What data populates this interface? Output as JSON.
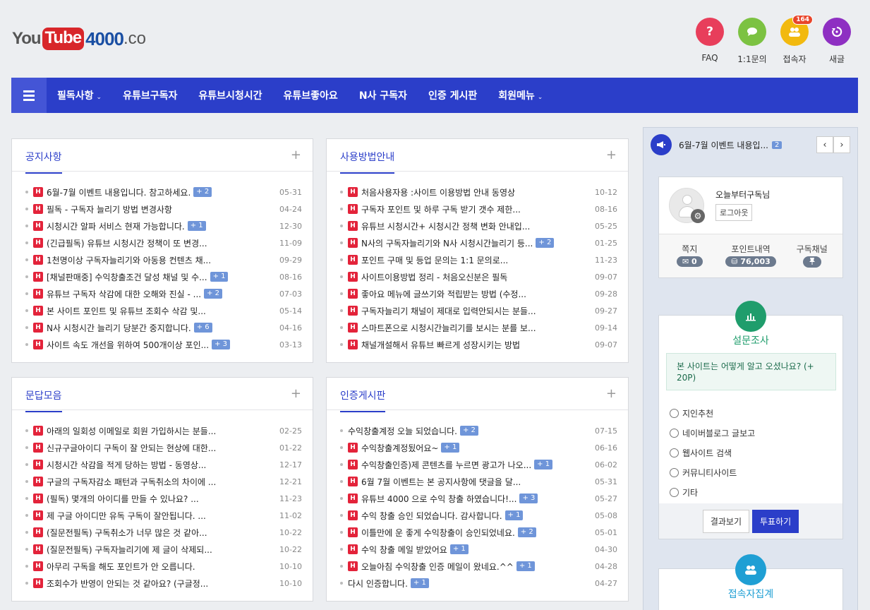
{
  "logo": {
    "you": "You",
    "tube": "Tube",
    "num": "4000",
    "co": ".co"
  },
  "top_icons": [
    {
      "label": "FAQ",
      "icon": "question-icon",
      "color": "#e83e5b",
      "glyph": "?"
    },
    {
      "label": "1:1문의",
      "icon": "chat-icon",
      "color": "#7cc242",
      "glyph": "💬"
    },
    {
      "label": "접속자",
      "icon": "users-icon",
      "color": "#f2b90f",
      "glyph": "👥",
      "badge": "164"
    },
    {
      "label": "새글",
      "icon": "refresh-icon",
      "color": "#8e2fc2",
      "glyph": "↺"
    }
  ],
  "nav": {
    "items": [
      {
        "label": "필독사항",
        "caret": true
      },
      {
        "label": "유튜브구독자"
      },
      {
        "label": "유튜브시청시간"
      },
      {
        "label": "유튜브좋아요"
      },
      {
        "label": "N사 구독자"
      },
      {
        "label": "인증 게시판"
      },
      {
        "label": "회원메뉴",
        "caret": true
      }
    ]
  },
  "boards": [
    {
      "title": "공지사항",
      "items": [
        {
          "text": "6월-7월 이벤트 내용입니다. 참고하세요.",
          "cnt": "+ 2",
          "date": "05-31",
          "h": true
        },
        {
          "text": "필독 - 구독자 늘리기 방법 변경사항",
          "date": "04-24",
          "h": true
        },
        {
          "text": "시청시간 알파 서비스 현재 가능합니다.",
          "cnt": "+ 1",
          "date": "12-30",
          "h": true
        },
        {
          "text": "(긴급필독) 유튜브 시청시간 정책이 또 변경...",
          "date": "11-09",
          "h": true
        },
        {
          "text": "1천명이상 구독자늘리기와 아동용 컨텐츠 채...",
          "date": "09-29",
          "h": true
        },
        {
          "text": "[채널판매중] 수익창출조건 달성 채널 및 수...",
          "cnt": "+ 1",
          "date": "08-16",
          "h": true
        },
        {
          "text": "유튜브 구독자 삭감에 대한 오해와 진실 - ...",
          "cnt": "+ 2",
          "date": "07-03",
          "h": true
        },
        {
          "text": "본 사이트 포인트 및 유튜브 조회수 삭감 및...",
          "date": "05-14",
          "h": true
        },
        {
          "text": "N사 시청시간 늘리기 당분간 중지합니다.",
          "cnt": "+ 6",
          "date": "04-16",
          "h": true
        },
        {
          "text": "사이트 속도 개선을 위하여 500개이상 포인...",
          "cnt": "+ 3",
          "date": "03-13",
          "h": true
        }
      ]
    },
    {
      "title": "사용방법안내",
      "items": [
        {
          "text": "처음사용자용 :사이트 이용방법 안내 동영상",
          "date": "10-12",
          "h": true
        },
        {
          "text": "구독자 포인트 및 하루 구독 받기 갯수 제한...",
          "date": "08-16",
          "h": true
        },
        {
          "text": "유튜브 시청시간+ 시청시간 정책 변화 안내입...",
          "date": "05-25",
          "h": true
        },
        {
          "text": "N사의 구독자늘리기와 N사 시청시간늘리기 등...",
          "cnt": "+ 2",
          "date": "01-25",
          "h": true
        },
        {
          "text": "포인트 구매 및 등업 문의는 1:1 문의로...",
          "date": "11-23",
          "h": true
        },
        {
          "text": "사이트이용방법 정리 - 처음오신분은 필독",
          "date": "09-07",
          "h": true
        },
        {
          "text": "좋아요 메뉴에 글쓰기와 적립받는 방법 (수정...",
          "date": "09-28",
          "h": true
        },
        {
          "text": "구독자늘리기 채널이 제대로 입력안되시는 분들...",
          "date": "09-27",
          "h": true
        },
        {
          "text": "스마트폰으로 시청시간늘리기를 보시는 분를 보...",
          "date": "09-14",
          "h": true
        },
        {
          "text": "채널개설해서 유튜브 빠르게 성장시키는 방법",
          "date": "09-07",
          "h": true
        }
      ]
    },
    {
      "title": "문답모음",
      "items": [
        {
          "text": "아래의 일회성 이메일로 회원 가입하시는 분들...",
          "date": "02-25",
          "h": true
        },
        {
          "text": "신규구글아이디 구독이 잘 안되는 현상에 대한...",
          "date": "01-22",
          "h": true
        },
        {
          "text": "시청시간 삭감을 적게 당하는 방법 - 동영상...",
          "date": "12-17",
          "h": true
        },
        {
          "text": "구글의 구독자감소 패턴과 구독취소의 차이에 ...",
          "date": "12-21",
          "h": true
        },
        {
          "text": "(필독) 몇개의 아이디를 만들 수 있나요? ...",
          "date": "11-23",
          "h": true
        },
        {
          "text": "제 구글 아이디만 유독 구독이 잘안됩니다. ...",
          "date": "11-02",
          "h": true
        },
        {
          "text": "(질문전필독) 구독취소가 너무 많은 것 같아...",
          "date": "10-22",
          "h": true
        },
        {
          "text": "(질문전필독) 구독자늘리기에 제 글이 삭제되...",
          "date": "10-22",
          "h": true
        },
        {
          "text": "아무리 구독을 해도 포인트가 안 오릅니다.",
          "date": "10-10",
          "h": true
        },
        {
          "text": "조회수가 반영이 안되는 것 같아요? (구글정...",
          "date": "10-10",
          "h": true
        }
      ]
    },
    {
      "title": "인증게시판",
      "items": [
        {
          "text": "수익창출계정 오늘 되었습니다.",
          "cnt": "+ 2",
          "date": "07-15",
          "h": false
        },
        {
          "text": "수익창출계정됬어요~",
          "cnt": "+ 1",
          "date": "06-16",
          "h": true
        },
        {
          "text": "수익창출인증)제 콘텐츠를 누르면 광고가 나오...",
          "cnt": "+ 1",
          "date": "06-02",
          "h": true
        },
        {
          "text": "6월 7월 이벤트는 본 공지사항에 댓글을 달...",
          "date": "05-31",
          "h": true
        },
        {
          "text": "유튜브 4000 으로 수익 창출 하였습니다!...",
          "cnt": "+ 3",
          "date": "05-27",
          "h": true
        },
        {
          "text": "수익 창출 승인 되었습니다. 감사합니다.",
          "cnt": "+ 1",
          "date": "05-08",
          "h": true
        },
        {
          "text": "이틀만에 운 좋게 수익창출이 승인되었네요.",
          "cnt": "+ 2",
          "date": "05-01",
          "h": true
        },
        {
          "text": "수익 창출 메일 받았어요",
          "cnt": "+ 1",
          "date": "04-30",
          "h": true
        },
        {
          "text": "오늘아침 수익창출 인증 메일이 왔네요.^^",
          "cnt": "+ 1",
          "date": "04-28",
          "h": true
        },
        {
          "text": "다시 인증합니다.",
          "cnt": "+ 1",
          "date": "04-27",
          "h": false
        }
      ]
    }
  ],
  "sidebar": {
    "notice": {
      "text": "6월-7월 이벤트 내용입...",
      "cnt": "2",
      "prev": "‹",
      "next": "›"
    },
    "profile": {
      "name": "오늘부터구독님",
      "logout": "로그아웃",
      "stats": [
        {
          "label": "쪽지",
          "value": "0",
          "icon": "✉"
        },
        {
          "label": "포인트내역",
          "value": "76,003",
          "icon": "⛁"
        },
        {
          "label": "구독채널",
          "value": "",
          "icon": "📌"
        }
      ]
    },
    "poll": {
      "title": "설문조사",
      "question": "본 사이트는 어떻게 알고 오셨나요? (+ 20P)",
      "options": [
        "지인추천",
        "네이버블로그 글보고",
        "웹사이트 검색",
        "커뮤니티사이트",
        "기타"
      ],
      "result_btn": "결과보기",
      "vote_btn": "투표하기"
    },
    "visitors": {
      "title": "접속자집계"
    }
  }
}
